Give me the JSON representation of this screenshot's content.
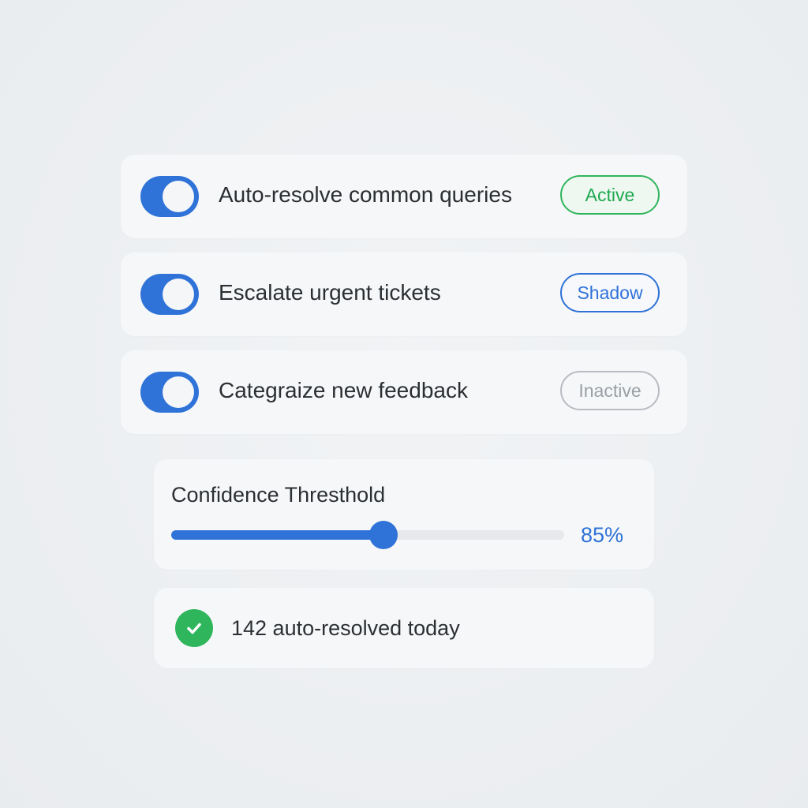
{
  "rules": [
    {
      "label": "Auto-resolve common queries",
      "enabled": true,
      "status": "Active",
      "status_type": "active"
    },
    {
      "label": "Escalate urgent tickets",
      "enabled": true,
      "status": "Shadow",
      "status_type": "shadow"
    },
    {
      "label": "Categraize new feedback",
      "enabled": true,
      "status": "Inactive",
      "status_type": "inactive"
    }
  ],
  "threshold": {
    "title": "Confidence Thresthold",
    "value_label": "85%",
    "slider_fraction": 0.54
  },
  "summary": {
    "icon": "check-circle-icon",
    "text": "142 auto-resolved today"
  },
  "colors": {
    "accent": "#2f72d8",
    "active": "#2fb55c",
    "inactive": "#9aa0a6"
  }
}
